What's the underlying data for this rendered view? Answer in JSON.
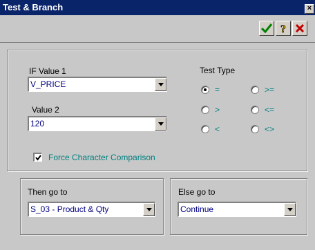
{
  "window": {
    "title": "Test & Branch",
    "close_label": "×"
  },
  "toolbar": {
    "ok_icon": "green-check-icon",
    "help_icon": "question-mark-icon",
    "cancel_icon": "red-x-icon"
  },
  "condition": {
    "if_value1_label": "IF  Value 1",
    "if_value1": "V_PRICE",
    "value2_label": "Value 2",
    "value2": "120",
    "force_char_label": "Force  Character Comparison",
    "force_char_checked": true
  },
  "test_type": {
    "label": "Test Type",
    "options": [
      {
        "label": "=",
        "checked": true
      },
      {
        "label": ">=",
        "checked": false
      },
      {
        "label": ">",
        "checked": false
      },
      {
        "label": "<=",
        "checked": false
      },
      {
        "label": "<",
        "checked": false
      },
      {
        "label": "<>",
        "checked": false
      }
    ]
  },
  "then": {
    "label": "Then go to",
    "value": "S_03 - Product & Qty"
  },
  "else": {
    "label": "Else go to",
    "value": "Continue"
  },
  "colors": {
    "titlebar": "#0a246a",
    "dialog": "#c8c8c8",
    "teal_text": "#008080",
    "value_text": "#000080"
  }
}
